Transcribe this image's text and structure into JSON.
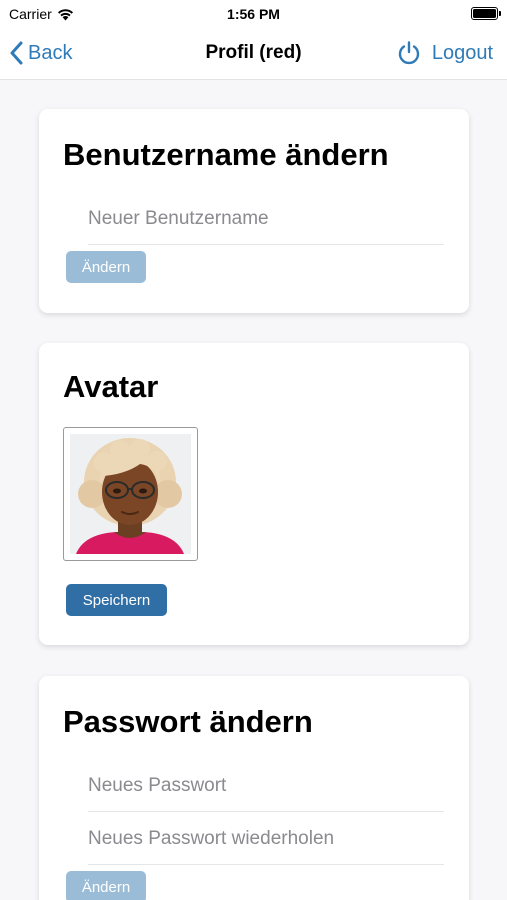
{
  "status_bar": {
    "carrier": "Carrier",
    "time": "1:56 PM"
  },
  "nav": {
    "back_label": "Back",
    "title": "Profil (red)",
    "logout_label": "Logout",
    "accent_color": "#2f7bb8"
  },
  "username_card": {
    "title": "Benutzername ändern",
    "input_placeholder": "Neuer Benutzername",
    "button_label": "Ändern",
    "button_state": "disabled"
  },
  "avatar_card": {
    "title": "Avatar",
    "button_label": "Speichern"
  },
  "password_card": {
    "title": "Passwort ändern",
    "new_password_placeholder": "Neues Passwort",
    "repeat_password_placeholder": "Neues Passwort wiederholen",
    "button_label": "Ändern",
    "button_state": "disabled"
  },
  "icons": [
    "wifi-icon",
    "battery-icon",
    "chevron-left-icon",
    "power-icon"
  ],
  "colors": {
    "button_primary": "#2f6fa6",
    "button_disabled": "#9bbcd6",
    "avatar_shirt": "#d81b60"
  }
}
